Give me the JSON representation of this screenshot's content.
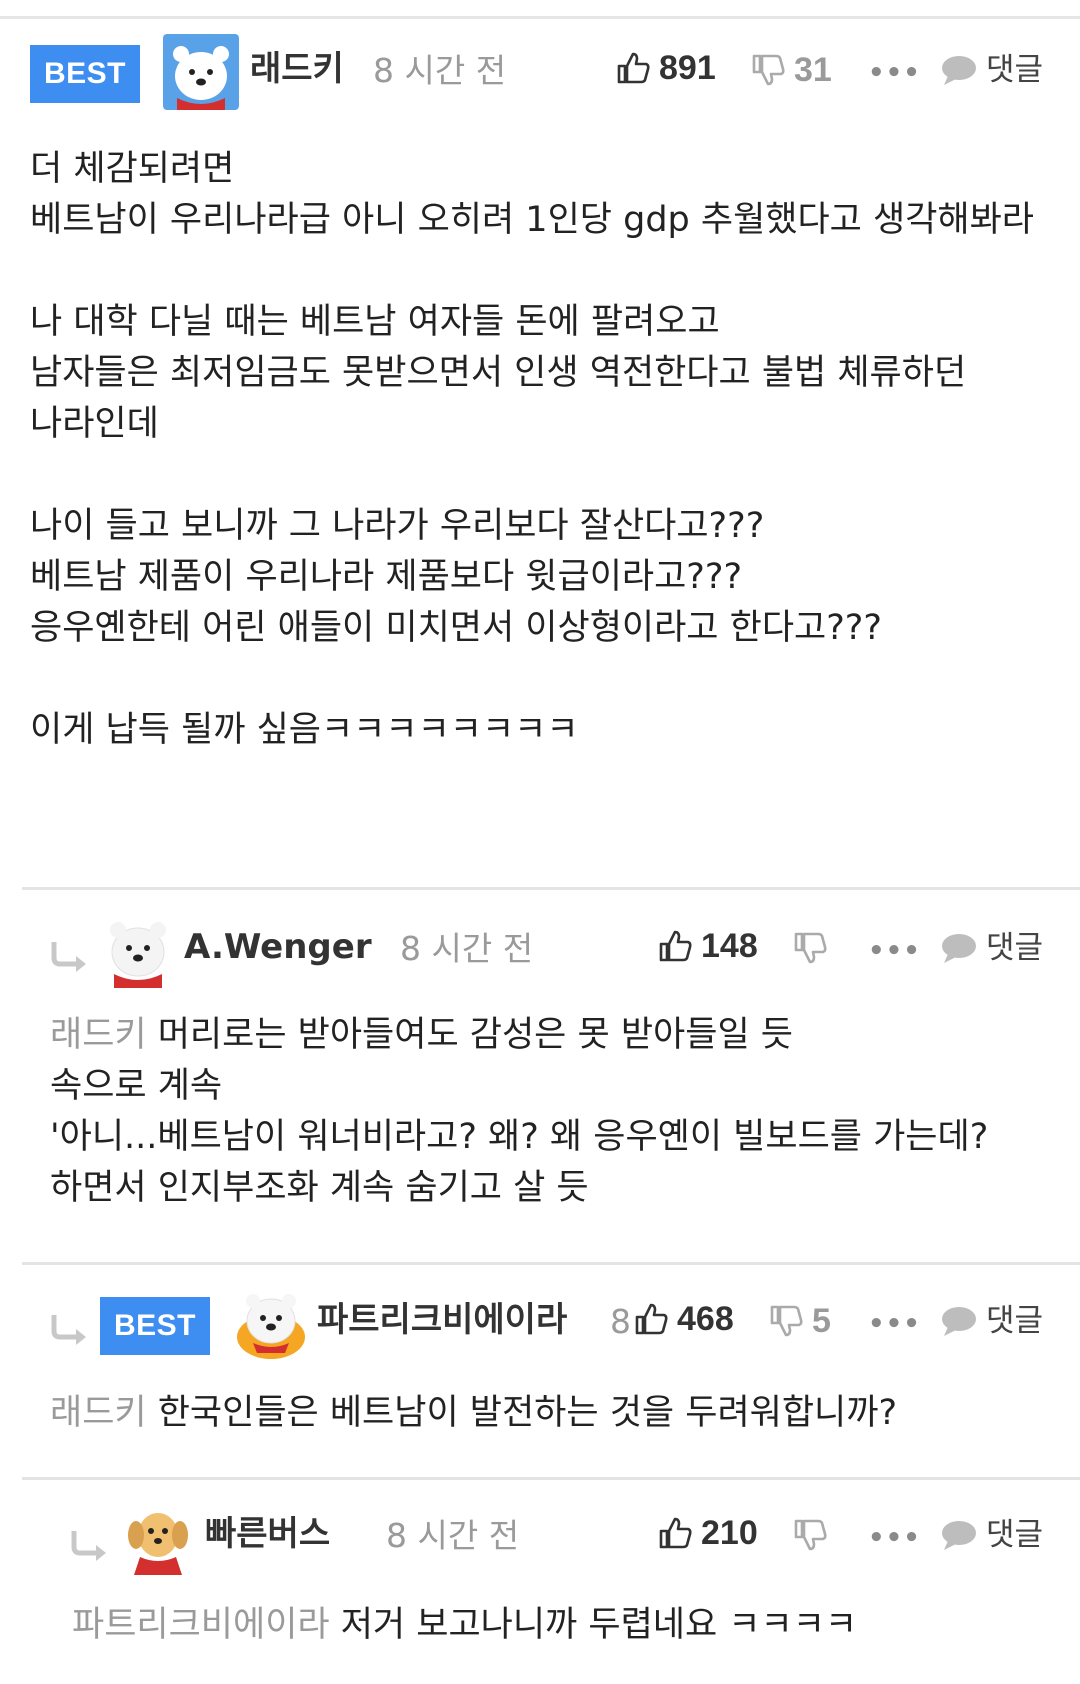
{
  "best_label": "BEST",
  "reply_label": "댓글",
  "more_label": "•••",
  "comments": [
    {
      "is_best": true,
      "nickname": "래드키",
      "time": "8 시간 전",
      "upvotes": "891",
      "downvotes": "31",
      "avatar": "polar-bear",
      "body": "더 체감되려면\n베트남이 우리나라급 아니 오히려 1인당 gdp 추월했다고 생각해봐라\n\n나 대학 다닐 때는 베트남 여자들 돈에 팔려오고\n남자들은 최저임금도 못받으면서 인생 역전한다고 불법 체류하던 나라인데\n\n나이 들고 보니까 그 나라가 우리보다 잘산다고???\n베트남 제품이 우리나라 제품보다 윗급이라고???\n응우옌한테 어린 애들이 미치면서 이상형이라고 한다고???\n\n이게 납득 될까 싶음ㅋㅋㅋㅋㅋㅋㅋㅋ"
    },
    {
      "is_best": false,
      "nickname": "A.Wenger",
      "time": "8 시간 전",
      "upvotes": "148",
      "downvotes": "",
      "avatar": "polar-bear",
      "mention": "래드키",
      "body": " 머리로는 받아들여도 감성은 못 받아들일 듯\n속으로 계속\n'아니...베트남이 워너비라고? 왜? 왜 응우옌이 빌보드를 가는데? 하면서 인지부조화 계속 숨기고 살 듯"
    },
    {
      "is_best": true,
      "nickname": "파트리크비에이라",
      "time_fragment": "8",
      "upvotes": "468",
      "downvotes": "5",
      "avatar": "polar-bear-orange",
      "mention": "래드키",
      "body": " 한국인들은 베트남이 발전하는 것을 두려워합니까?"
    },
    {
      "is_best": false,
      "nickname": "빠른버스",
      "time": "8 시간 전",
      "upvotes": "210",
      "downvotes": "",
      "avatar": "puppy",
      "mention": "파트리크비에이라",
      "body": " 저거 보고나니까 두렵네요 ㅋㅋㅋㅋ"
    }
  ],
  "colors": {
    "best_badge": "#3d8ef0",
    "mention": "#9a9a9a",
    "meta_gray": "#9a9a9a",
    "divider": "#e4e4e4"
  },
  "icons": [
    "thumbs-up-icon",
    "thumbs-down-icon",
    "more-icon",
    "speech-bubble-icon",
    "reply-arrow-icon"
  ]
}
